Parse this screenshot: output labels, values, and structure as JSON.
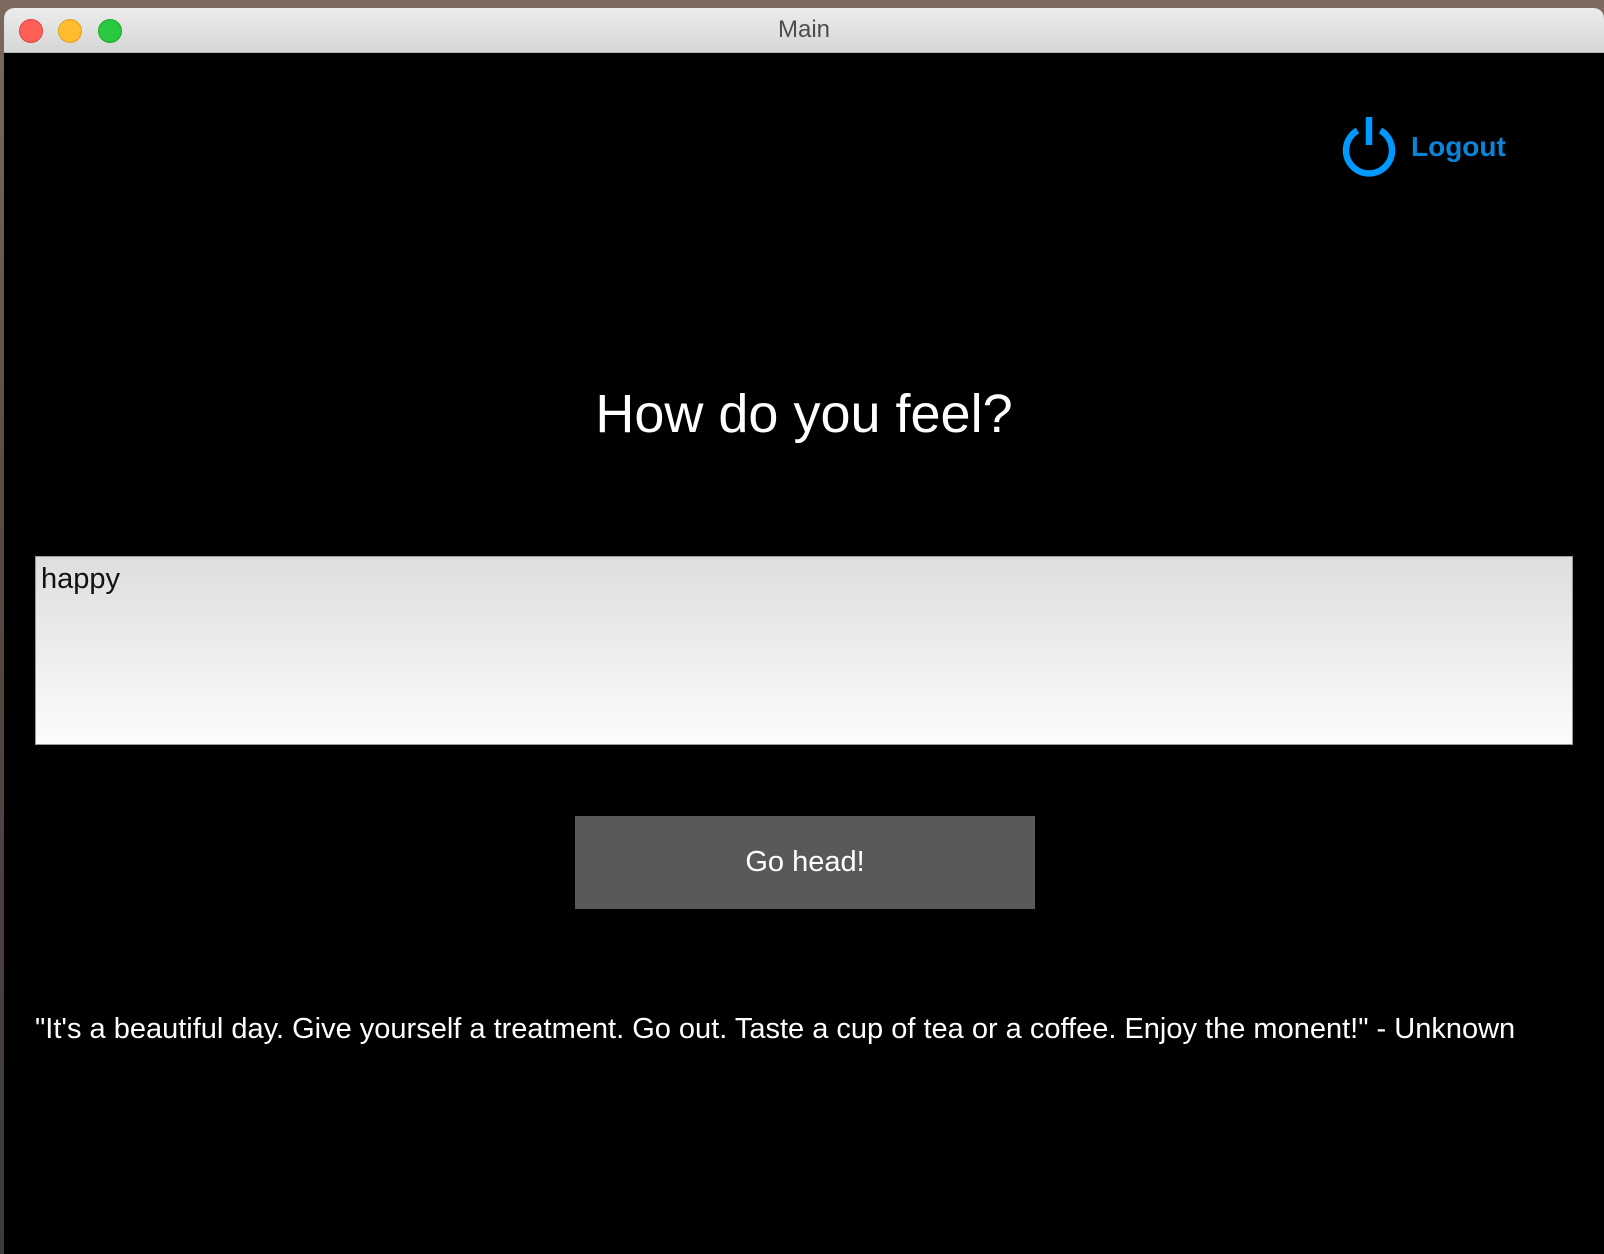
{
  "window": {
    "title": "Main"
  },
  "header": {
    "logout_label": "Logout",
    "logout_icon": "power-icon",
    "accent_color": "#0a84d8"
  },
  "main": {
    "heading": "How do you feel?",
    "mood_input_value": "happy",
    "submit_label": "Go head!",
    "quote": "\"It's a beautiful day. Give yourself a treatment. Go out. Taste a cup of tea or a coffee. Enjoy the monent!\" - Unknown"
  },
  "colors": {
    "background": "#000000",
    "button_bg": "#595959",
    "text": "#ffffff"
  }
}
